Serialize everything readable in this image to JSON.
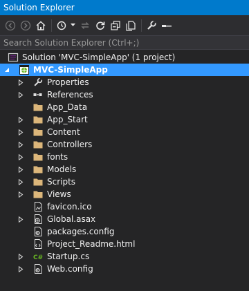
{
  "window": {
    "title": "Solution Explorer"
  },
  "toolbar": {
    "icons": [
      "back-icon",
      "forward-icon",
      "home-icon",
      "history-icon",
      "sync-icon",
      "refresh-icon",
      "collapse-all-icon",
      "show-all-files-icon",
      "properties-icon",
      "preview-icon"
    ]
  },
  "search": {
    "placeholder": "Search Solution Explorer (Ctrl+;)"
  },
  "solution": {
    "label": "Solution 'MVC-SimpleApp' (1 project)"
  },
  "project": {
    "label": "MVC-SimpleApp"
  },
  "items": [
    {
      "label": "Properties",
      "icon": "wrench-icon",
      "expandable": true
    },
    {
      "label": "References",
      "icon": "references-icon",
      "expandable": true
    },
    {
      "label": "App_Data",
      "icon": "folder-icon",
      "expandable": false
    },
    {
      "label": "App_Start",
      "icon": "folder-icon",
      "expandable": true
    },
    {
      "label": "Content",
      "icon": "folder-icon",
      "expandable": true
    },
    {
      "label": "Controllers",
      "icon": "folder-icon",
      "expandable": true
    },
    {
      "label": "fonts",
      "icon": "folder-icon",
      "expandable": true
    },
    {
      "label": "Models",
      "icon": "folder-icon",
      "expandable": true
    },
    {
      "label": "Scripts",
      "icon": "folder-icon",
      "expandable": true
    },
    {
      "label": "Views",
      "icon": "folder-icon",
      "expandable": true
    },
    {
      "label": "favicon.ico",
      "icon": "image-file-icon",
      "expandable": false
    },
    {
      "label": "Global.asax",
      "icon": "asax-file-icon",
      "expandable": true
    },
    {
      "label": "packages.config",
      "icon": "config-file-icon",
      "expandable": false
    },
    {
      "label": "Project_Readme.html",
      "icon": "html-file-icon",
      "expandable": false
    },
    {
      "label": "Startup.cs",
      "icon": "csharp-file-icon",
      "expandable": true
    },
    {
      "label": "Web.config",
      "icon": "config-file-icon",
      "expandable": true
    }
  ],
  "colors": {
    "title_bar": "#007acc",
    "background": "#252526",
    "toolbar": "#2d2d30",
    "selection": "#3399ff",
    "folder": "#dcb67a",
    "text": "#f1f1f1",
    "placeholder": "#999999",
    "csharp": "#68b723"
  }
}
